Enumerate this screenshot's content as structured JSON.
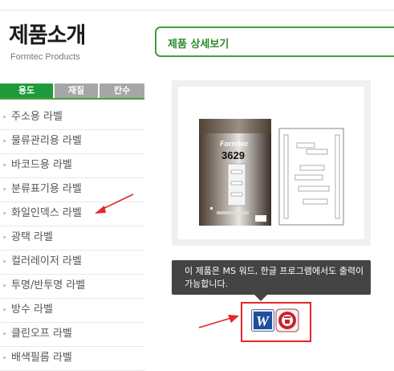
{
  "header": {
    "title": "제품소개",
    "subtitle": "Formtec Products"
  },
  "tabs": [
    {
      "label": "용도",
      "active": true
    },
    {
      "label": "재질",
      "active": false
    },
    {
      "label": "칸수",
      "active": false
    }
  ],
  "menu": [
    {
      "label": "주소용 라벨"
    },
    {
      "label": "물류관리용 라벨"
    },
    {
      "label": "바코드용 라벨"
    },
    {
      "label": "분류표기용 라벨"
    },
    {
      "label": "화일인덱스 라벨"
    },
    {
      "label": "광택 라벨"
    },
    {
      "label": "컬러레이저 라벨"
    },
    {
      "label": "투명/반투명 라벨"
    },
    {
      "label": "방수 라벨"
    },
    {
      "label": "클린오프 라벨"
    },
    {
      "label": "배색필름 라벨"
    }
  ],
  "detail": {
    "heading": "제품 상세보기"
  },
  "product": {
    "brand": "Formtec",
    "code": "3629"
  },
  "tooltip": {
    "text": "이 제품은 MS 워드, 한글 프로그램에서도 출력이 가능합니다."
  },
  "icons": {
    "word": "ms-word-icon",
    "hangul": "hangul-word-processor-icon"
  },
  "colors": {
    "accent": "#1f9a3a",
    "highlight": "#e3262a"
  }
}
